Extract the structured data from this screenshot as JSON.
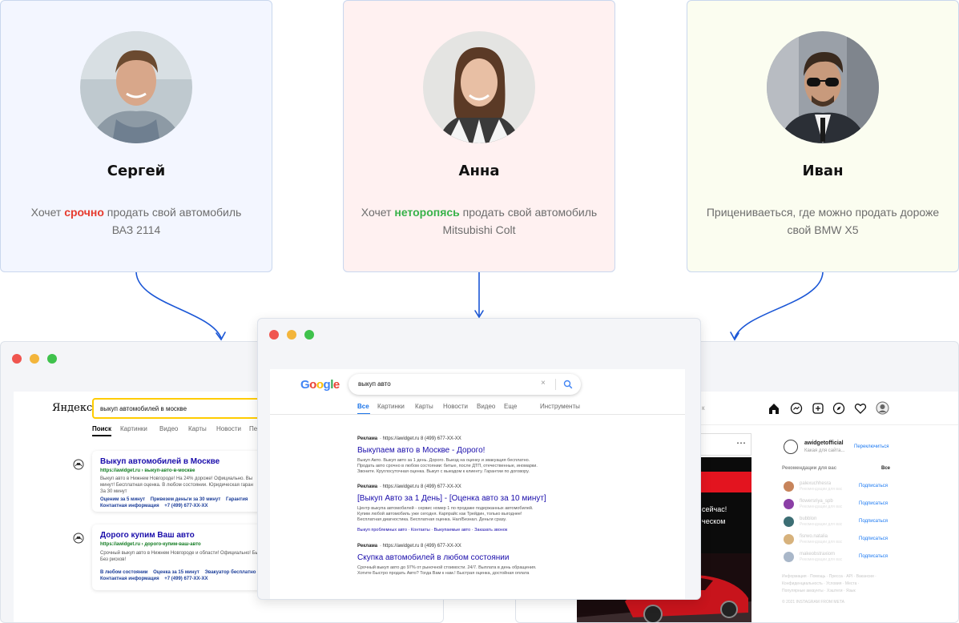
{
  "personas": [
    {
      "name": "Сергей",
      "desc_pre": "Хочет ",
      "desc_hl": "срочно",
      "desc_post": " продать свой автомобиль",
      "desc_line2": "ВАЗ 2114",
      "bg": "#f3f6ff"
    },
    {
      "name": "Анна",
      "desc_pre": "Хочет ",
      "desc_hl": "неторопясь",
      "desc_post": " продать свой автомобиль",
      "desc_line2": "Mitsubishi Colt",
      "bg": "#fff1f1"
    },
    {
      "name": "Иван",
      "desc_pre": "Прицениваеться, где можно продать дороже",
      "desc_hl": "",
      "desc_post": "",
      "desc_line2": "свой BMW X5",
      "bg": "#fbfdf0"
    }
  ],
  "yandex": {
    "logo": "Яндекс",
    "query": "выкуп автомобилей в москве",
    "tabs": [
      "Поиск",
      "Картинки",
      "Видео",
      "Карты",
      "Новости",
      "Пе"
    ],
    "results": [
      {
        "title": "Выкуп автомобилей в Москве",
        "url": "https://awidget.ru › выкуп-авто-в-москве",
        "snippet1": "Выкуп авто в Нижнем Новгороде! На 24% дороже! Официально. Вы",
        "snippet2": "минут! Бесплатная оценка. В любом состоянии. Юридическая гаран",
        "snippet3": "За 30 минут",
        "links1": "Оценим за 5 минут    Привезем деньги за 30 минут    Гарантия",
        "links2": "Контактная информация    +7 (499) 677-XX-XX"
      },
      {
        "title": "Дорого купим Ваш авто",
        "url": "https://awidget.ru › дорого-купим-ваш-авто",
        "snippet1": "Срочный выкуп авто в Нижнем Новгороде и области! Официально! Бы",
        "snippet2": "Без рисков!",
        "snippet3": "",
        "links1": "В любом состоянии    Оценка за 15 минут    Эвакуатор бесплатно",
        "links2": "Контактная информация    +7 (499) 677-XX-XX"
      }
    ]
  },
  "google": {
    "logo": "Google",
    "query": "выкуп авто",
    "tabs": [
      "Все",
      "Картинки",
      "Карты",
      "Новости",
      "Видео",
      "Еще"
    ],
    "tools": "Инструменты",
    "results": [
      {
        "ad": "Реклама",
        "url": " · https://awidget.ru  8 (499) 677-XX-XX",
        "title": "Выкупаем авто в Москве - Дорого!",
        "snippet1": "Выкуп Авто. Выкуп авто за 1 день. Дорого. Выезд на оценку и эвакуация бесплатно.",
        "snippet2": "Продать авто срочно в любом состоянии: битые, после ДТП, отечественные, иномарки.",
        "snippet3": "Звоните. Круглосуточная оценка. Выкуп с выездом к клиенту. Гарантии по договору.",
        "links": ""
      },
      {
        "ad": "Реклама",
        "url": " · https://awidget.ru  8 (499) 677-XX-XX",
        "title": "[Выкуп Авто за 1 День] - [Оценка авто за 10 минут]",
        "snippet1": "Центр выкупа автомобилей - сервис номер 1 по продаже подержанных автомобилей.",
        "snippet2": "Купим любой автомобиль уже сегодня. Карпрайс как Трейдин, только выгоднее!",
        "snippet3": "Бесплатная диагностика. Бесплатная оценка. Нал/Безнал. Деньги сразу.",
        "links": "Выкуп проблемных авто · Контакты · Выкупаемые авто · Заказать звонок"
      },
      {
        "ad": "Реклама",
        "url": " · https://awidget.ru  8 (499) 677-XX-XX",
        "title": "Скупка автомобилей в любом состоянии",
        "snippet1": "Срочный выкуп авто до 97% от рыночной стоимости. 24/7. Выплата в день обращения.",
        "snippet2": "Хотите Быстро продать Авто? Тогда Вам к нам.! Быстрая оценка, достойная оплата",
        "snippet3": "",
        "links": ""
      }
    ]
  },
  "instagram": {
    "search_fragment": "к",
    "account": "awidgetofficial",
    "account_sub": "Какая для сайта...",
    "switch": "Переключиться",
    "rec_title": "Рекомендации для вас",
    "rec_all": "Все",
    "suggestions": [
      {
        "user": "palexuchhesra",
        "sub": "Рекомендации для вас",
        "action": "Подписаться"
      },
      {
        "user": "flowersriya_spb",
        "sub": "Рекомендации для вас",
        "action": "Подписаться"
      },
      {
        "user": "bubblon",
        "sub": "Рекомендации для вас",
        "action": "Подписаться"
      },
      {
        "user": "fisrwo.natalia",
        "sub": "Рекомендации для вас",
        "action": "Подписаться"
      },
      {
        "user": "makeobstraxiom",
        "sub": "Рекомендации для вас",
        "action": "Подписаться"
      }
    ],
    "footer1": "Информация · Помощь · Пресса · API · Вакансии ·",
    "footer2": "Конфиденциальность · Условия · Места ·",
    "footer3": "Популярные аккаунты · Хэштеги · Язык",
    "copyright": "© 2021 INSTAGRAM FROM META",
    "ad_text1": "сейчас!",
    "ad_text2": "ческом",
    "post_menu": "⋯"
  },
  "colors": {
    "accent_blue": "#1a56d6",
    "mac_red": "#f0554f",
    "mac_yellow": "#f3b53b",
    "mac_green": "#3fc24c"
  }
}
